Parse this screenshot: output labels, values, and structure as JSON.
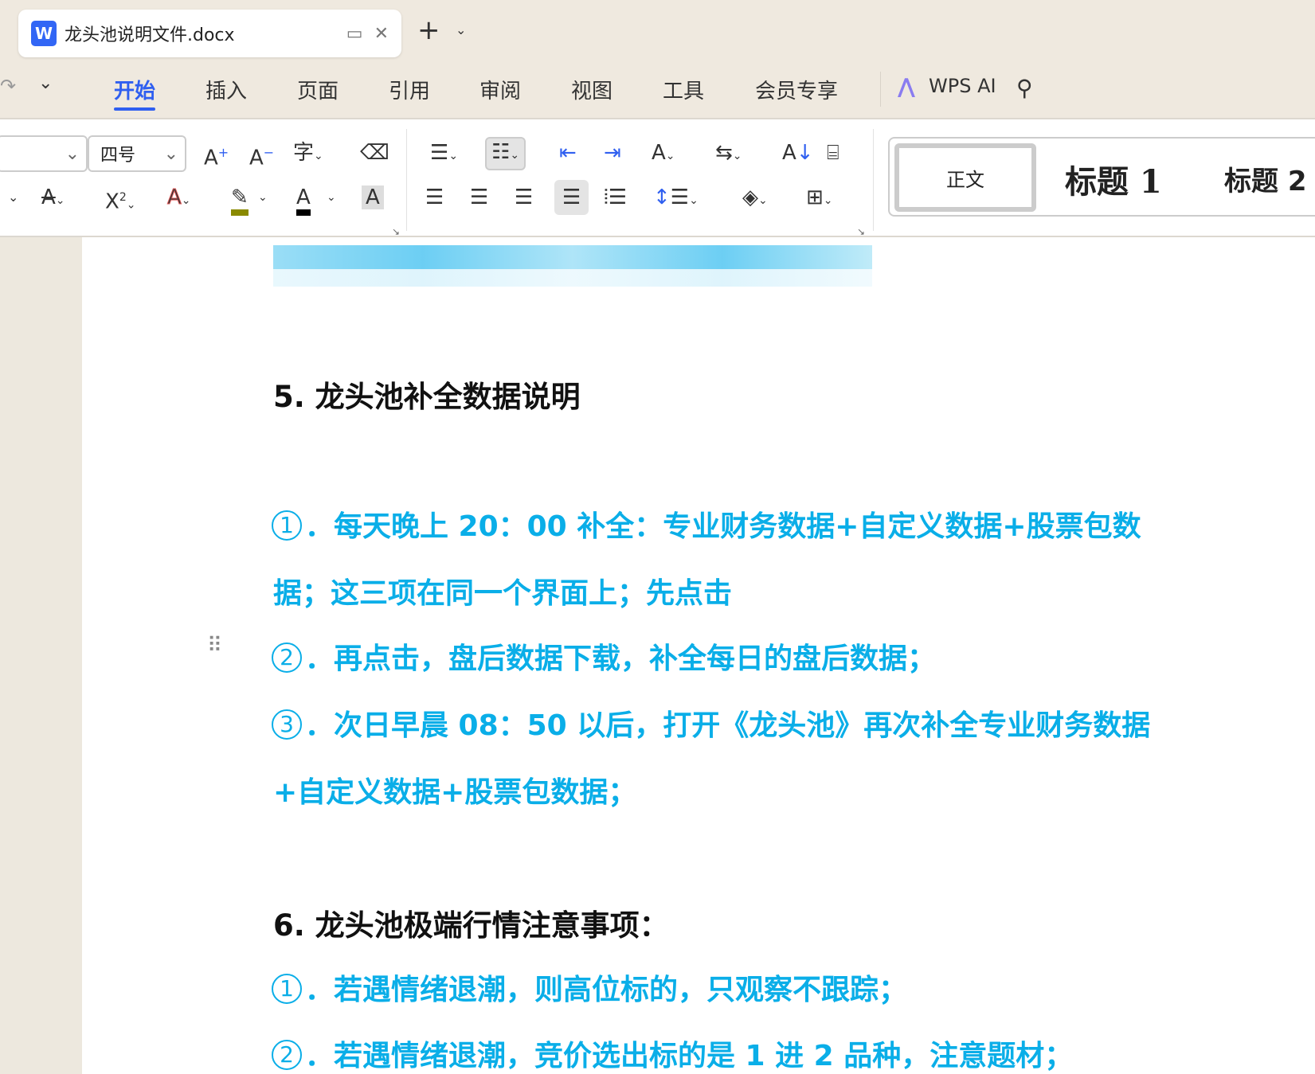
{
  "tab": {
    "title": "龙头池说明文件.docx",
    "logo": "W"
  },
  "menu": [
    "开始",
    "插入",
    "页面",
    "引用",
    "审阅",
    "视图",
    "工具",
    "会员专享"
  ],
  "wps_ai": "WPS AI",
  "toolbar": {
    "font_size": "四号",
    "styles": [
      "正文",
      "标题 1",
      "标题 2"
    ]
  },
  "doc": {
    "h5": "5. 龙头池补全数据说明",
    "s5": [
      {
        "n": "1",
        "text": "．每天晚上 20：00 补全：专业财务数据+自定义数据+股票包数"
      },
      {
        "n": "",
        "text": "据；这三项在同一个界面上；先点击"
      },
      {
        "n": "2",
        "text": "．再点击，盘后数据下载，补全每日的盘后数据；"
      },
      {
        "n": "3",
        "text": "．次日早晨 08：50 以后，打开《龙头池》再次补全专业财务数据"
      },
      {
        "n": "",
        "text": "+自定义数据+股票包数据；"
      }
    ],
    "h6": "6. 龙头池极端行情注意事项：",
    "s6": [
      {
        "n": "1",
        "text": "．若遇情绪退潮，则高位标的，只观察不跟踪；"
      },
      {
        "n": "2",
        "text": "．若遇情绪退潮，竞价选出标的是 1 进 2 品种，注意题材；"
      }
    ]
  },
  "colors": {
    "accent": "#2f5ff0",
    "text_blue": "#0aaee8"
  }
}
